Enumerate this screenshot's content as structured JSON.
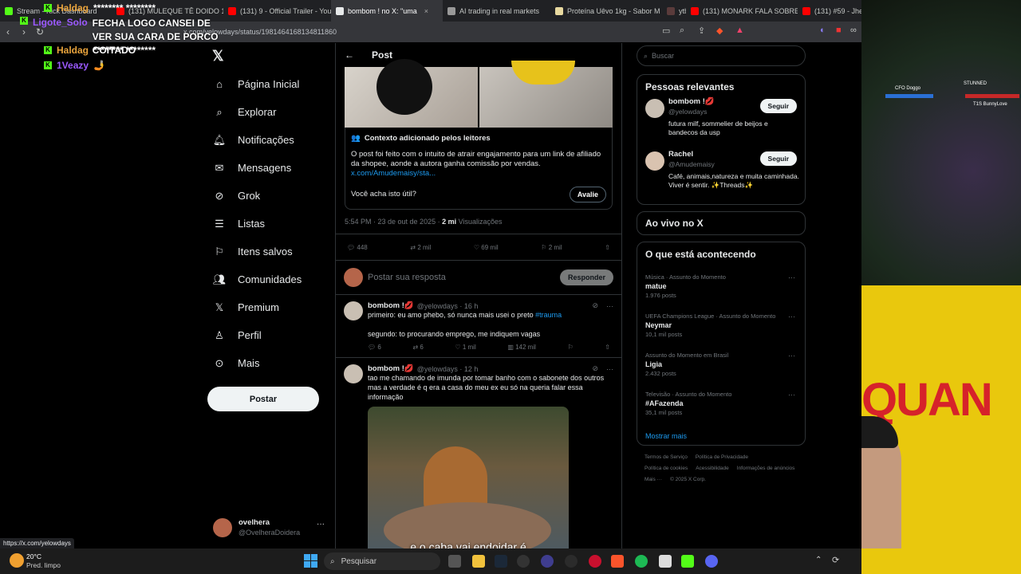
{
  "browser": {
    "tabs": [
      {
        "label": "Stream - Kick Dashboard",
        "color": "#53fc18"
      },
      {
        "label": "(131) MULEQUE TÊ DOIDO 1",
        "color": "#ff0000"
      },
      {
        "label": "(131) 9 - Official Trailer - YouT",
        "color": "#ff0000"
      },
      {
        "label": "bombom ! no X: \"uma",
        "color": "#e7e9ea",
        "active": true
      },
      {
        "label": "AI trading in real markets",
        "color": "#999999"
      },
      {
        "label": "Proteína Uêvo 1kg - Sabor M",
        "color": "#e8d9a0"
      },
      {
        "label": "ytb",
        "color": "#5a3b3b"
      },
      {
        "label": "(131) MONARK FALA SOBRE",
        "color": "#ff0000"
      },
      {
        "label": "(131) #59 - Jhe",
        "color": "#ff0000"
      }
    ],
    "url": "x.com/yelowdays/status/1981464168134811860"
  },
  "chat": [
    {
      "user": "Haldag",
      "msg": "******** ********",
      "color": "#e8a33c"
    },
    {
      "user": "Ligote_Solo",
      "msg": "FECHA LOGO CANSEI DE VER SUA CARA DE PORCO COITADO",
      "color": "#9b59ff"
    },
    {
      "user": "Haldag",
      "msg": "******** ********",
      "color": "#e8a33c"
    },
    {
      "user": "1Veazy",
      "msg": "🤳",
      "color": "#9b59ff"
    }
  ],
  "nav": {
    "items": [
      "Página Inicial",
      "Explorar",
      "Notificações",
      "Mensagens",
      "Grok",
      "Listas",
      "Itens salvos",
      "Comunidades",
      "Premium",
      "Perfil",
      "Mais"
    ],
    "post_button": "Postar",
    "account_name": "ovelhera",
    "account_handle": "@OvelheraDoidera"
  },
  "main": {
    "header": "Post",
    "note": {
      "title": "Contexto adicionado pelos leitores",
      "text": "O post foi feito com o intuito de atrair engajamento para um link de afiliado da shopee, aonde a autora ganha comissão por vendas.",
      "link": "x.com/Amudemaisy/sta...",
      "question": "Você acha isto útil?",
      "rate_button": "Avalie"
    },
    "timestamp": "5:54 PM · 23 de out de 2025 · ",
    "views_count": "2 mi",
    "views_label": "Visualizações",
    "stats": {
      "replies": "448",
      "reposts": "2 mil",
      "likes": "69 mil",
      "bookmarks": "2 mil"
    },
    "reply_placeholder": "Postar sua resposta",
    "reply_button": "Responder",
    "replies": [
      {
        "name": "bombom !💋",
        "handle": "@yelowdays · 16 h",
        "text1": "primeiro: eu amo phebo, só nunca mais usei o preto ",
        "hashtag": "#trauma",
        "text2": "segundo: to procurando emprego, me indiquem vagas",
        "stats": {
          "replies": "6",
          "reposts": "6",
          "likes": "1 mil",
          "views": "142 mil"
        }
      },
      {
        "name": "bombom !💋",
        "handle": "@yelowdays · 12 h",
        "text1": "tao me chamando de imunda por tomar banho com o sabonete dos outros mas a verdade é q era a casa do meu ex eu só na queria falar essa informação",
        "caption": "e o caba vai endoidar é"
      }
    ]
  },
  "right": {
    "search_placeholder": "Buscar",
    "relevant_title": "Pessoas relevantes",
    "people": [
      {
        "name": "bombom !💋",
        "handle": "@yelowdays",
        "bio": "futura milf, sommelier de beijos e bandecos da usp",
        "button": "Seguir"
      },
      {
        "name": "Rachel",
        "handle": "@Amudemaisy",
        "bio": "Café, animais,natureza e muita caminhada. Viver é sentir. ✨Threads✨",
        "button": "Seguir"
      }
    ],
    "live_title": "Ao vivo no X",
    "trends_title": "O que está acontecendo",
    "trends": [
      {
        "meta": "Música · Assunto do Momento",
        "name": "matue",
        "posts": "1.976 posts"
      },
      {
        "meta": "UEFA Champions League · Assunto do Momento",
        "name": "Neymar",
        "posts": "10,1 mil posts"
      },
      {
        "meta": "Assunto do Momento em Brasil",
        "name": "Ligia",
        "posts": "2.432 posts"
      },
      {
        "meta": "Televisão · Assunto do Momento",
        "name": "#AFazenda",
        "posts": "35,1 mil posts"
      }
    ],
    "show_more": "Mostrar mais",
    "footer": [
      "Termos de Serviço",
      "Política de Privacidade",
      "Política de cookies",
      "Acessibilidade",
      "Informações de anúncios",
      "Mais ···",
      "© 2025 X Corp."
    ]
  },
  "stream": {
    "bigtext": "QUAN",
    "players": [
      "CFO Doggo",
      "STUNNED",
      "T1S BunnyLove"
    ]
  },
  "taskbar": {
    "temp": "20°C",
    "weather": "Pred. limpo",
    "search": "Pesquisar",
    "status_url": "https://x.com/yelowdays"
  }
}
